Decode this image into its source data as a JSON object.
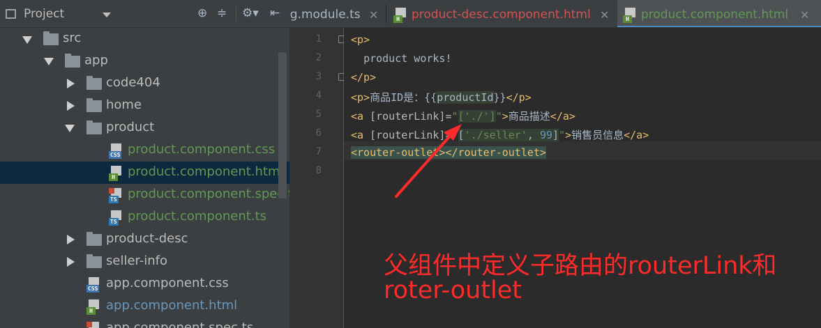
{
  "project_panel": {
    "title": "Project"
  },
  "tree": [
    {
      "name": "src",
      "kind": "folder",
      "state": "open"
    },
    {
      "name": "app",
      "kind": "folder",
      "state": "open"
    },
    {
      "name": "code404",
      "kind": "folder",
      "state": "closed"
    },
    {
      "name": "home",
      "kind": "folder",
      "state": "closed"
    },
    {
      "name": "product",
      "kind": "folder",
      "state": "open"
    },
    {
      "name": "product.component.css",
      "kind": "css",
      "color": "green"
    },
    {
      "name": "product.component.html",
      "kind": "html",
      "color": "green",
      "selected": true
    },
    {
      "name": "product.component.spec.ts",
      "kind": "spec",
      "color": "green"
    },
    {
      "name": "product.component.ts",
      "kind": "ts",
      "color": "green"
    },
    {
      "name": "product-desc",
      "kind": "folder",
      "state": "closed"
    },
    {
      "name": "seller-info",
      "kind": "folder",
      "state": "closed"
    },
    {
      "name": "app.component.css",
      "kind": "css",
      "color": "default"
    },
    {
      "name": "app.component.html",
      "kind": "html",
      "color": "blue"
    },
    {
      "name": "app.component.spec.ts",
      "kind": "spec",
      "color": "default"
    }
  ],
  "tabs": [
    {
      "label": "ng.module.ts",
      "active": false
    },
    {
      "label": "product-desc.component.html",
      "active": false
    },
    {
      "label": "product.component.html",
      "active": true
    }
  ],
  "editor": {
    "line_numbers": [
      "1",
      "2",
      "3",
      "4",
      "5",
      "6",
      "7",
      "8"
    ],
    "lines": {
      "l1": {
        "open": "<p>"
      },
      "l2": {
        "text": "product works!"
      },
      "l3": {
        "close": "</p>"
      },
      "l4": {
        "p_open": "<p>",
        "label": "商品ID是：{{",
        "var": "productId",
        "end": "}}",
        "p_close": "</p>"
      },
      "l5": {
        "a_open": "<a",
        "attr": " [routerLink]=",
        "q1": "\"",
        "value": "['./']",
        "q2": "\"",
        "gt": ">",
        "text": "商品描述",
        "a_close": "</a>"
      },
      "l6": {
        "a_open": "<a",
        "attr": " [routerLink]=",
        "q1": "\"",
        "lb": "[",
        "path": "'./seller'",
        "comma": ", ",
        "num": "99",
        "rb": "]",
        "q2": "\"",
        "gt": ">",
        "text": "销售员信息",
        "a_close": "</a>"
      },
      "l7": {
        "open": "<router-outlet>",
        "close": "</router-outlet>"
      }
    }
  },
  "annotation": {
    "line1": "父组件中定义子路由的routerLink和",
    "line2": "roter-outlet",
    "color": "#ff2a2a"
  },
  "colors": {
    "accent": "#4a88c7",
    "selection": "#0d293e",
    "tag": "#e8bf6a",
    "string": "#6a8759",
    "green_file": "#629755",
    "blue_file": "#6897bb"
  }
}
